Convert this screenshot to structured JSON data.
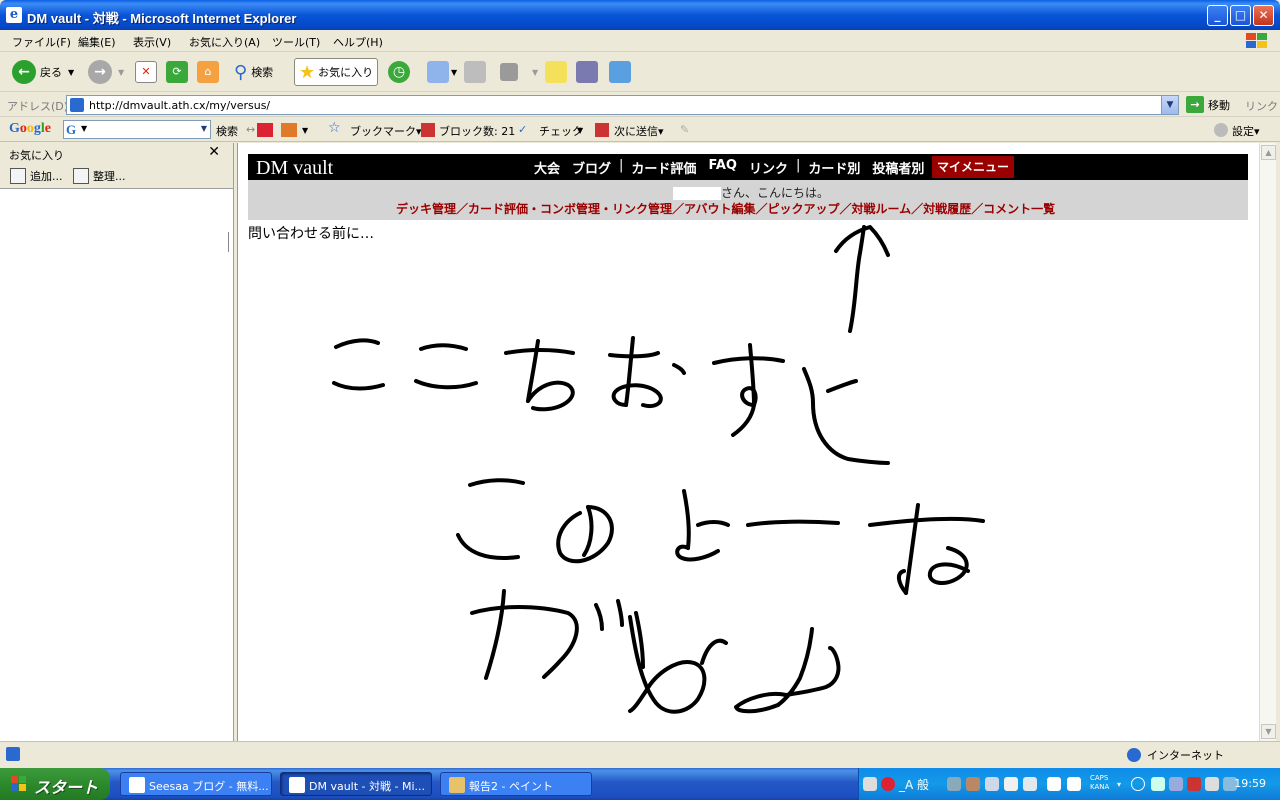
{
  "window": {
    "title": "DM vault - 対戦 - Microsoft Internet Explorer"
  },
  "menu": [
    "ファイル(F)",
    "編集(E)",
    "表示(V)",
    "お気に入り(A)",
    "ツール(T)",
    "ヘルプ(H)"
  ],
  "toolbar": {
    "back": "戻る",
    "search": "検索",
    "favorites": "お気に入り"
  },
  "address": {
    "label": "アドレス(D)",
    "url": "http://dmvault.ath.cx/my/versus/",
    "go": "移動",
    "links": "リンク"
  },
  "google_toolbar": {
    "logo": "Google",
    "search": "検索",
    "bookmarks": "ブックマーク▾",
    "popups": "ブロック数: 21",
    "check": "チェック",
    "sendto": "次に送信▾",
    "settings": "設定▾"
  },
  "favorites_pane": {
    "title": "お気に入り",
    "add": "追加...",
    "organize": "整理..."
  },
  "site": {
    "logo": "DM vault",
    "nav": [
      "大会",
      "ブログ",
      "カード評価",
      "FAQ",
      "リンク",
      "カード別",
      "投稿者別"
    ],
    "my_menu": "マイメニュー",
    "greeting": "さん、こんにちは。",
    "sub_links": "デッキ管理／カード評価・コンボ管理・リンク管理／アバウト編集／ピックアップ／対戦ルーム／対戦履歴／コメント一覧",
    "page_text": "問い合わせる前に…"
  },
  "status": {
    "zone": "インターネット"
  },
  "taskbar": {
    "start": "スタート",
    "tasks": [
      "Seesaa ブログ - 無料...",
      "DM vault - 対戦 - Mi...",
      "報告2 - ペイント"
    ],
    "ime": "_A 般",
    "caps": "CAPS",
    "kana": "KANA",
    "clock": "19:59"
  }
}
